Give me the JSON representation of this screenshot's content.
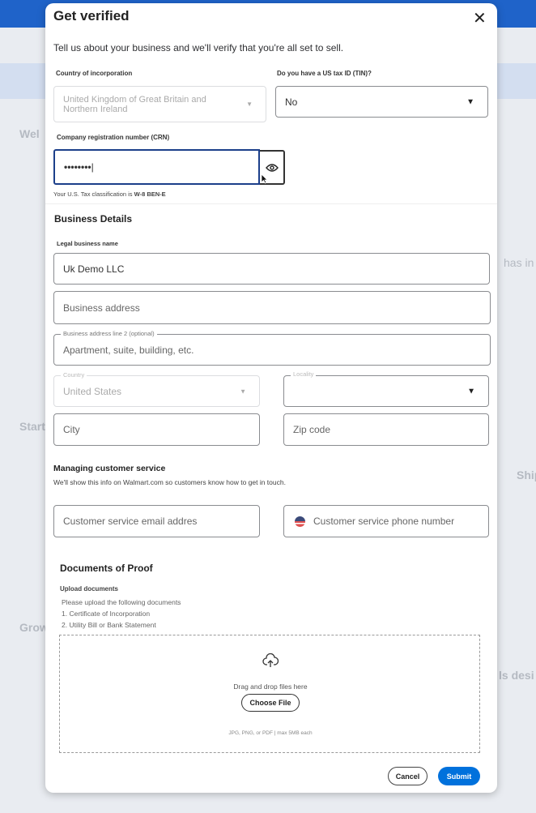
{
  "background": {
    "fragments": [
      "Wel",
      "has in",
      "Start",
      "Grow",
      "Ship",
      "ls desi"
    ]
  },
  "modal": {
    "title": "Get verified",
    "intro": "Tell us about your business and we'll verify that you're all set to sell.",
    "country_of_incorporation": {
      "label": "Country of incorporation",
      "value": "United Kingdom of Great Britain and Northern Ireland"
    },
    "us_tax_id": {
      "label": "Do you have a US tax ID (TIN)?",
      "value": "No"
    },
    "crn": {
      "label": "Company registration number (CRN)",
      "value": "••••••••"
    },
    "tax_classification": {
      "prefix": "Your U.S. Tax classification is",
      "value": "W-8 BEN-E"
    },
    "business_details": {
      "heading": "Business Details",
      "legal_name_label": "Legal business name",
      "legal_name_value": "Uk Demo LLC",
      "address_placeholder": "Business address",
      "address2_label": "Business address line 2 (optional)",
      "address2_placeholder": "Apartment, suite, building, etc.",
      "country_label": "Country",
      "country_value": "United States",
      "locality_label": "Locality",
      "city_placeholder": "City",
      "zip_placeholder": "Zip code"
    },
    "customer_service": {
      "heading": "Managing customer service",
      "description": "We'll show this info on Walmart.com so customers know how to get in touch.",
      "email_placeholder": "Customer service email addres",
      "phone_placeholder": "Customer service phone number"
    },
    "documents": {
      "heading": "Documents of Proof",
      "upload_label": "Upload documents",
      "instructions": [
        "Please upload the following documents",
        "1. Certificate of Incorporation",
        "2. Utility Bill or Bank Statement"
      ],
      "drop_text": "Drag and drop files here",
      "choose_file": "Choose File",
      "file_hint": "JPG, PNG, or PDF | max 5MB each"
    },
    "cancel": "Cancel",
    "submit": "Submit"
  },
  "colors": {
    "accent": "#0071dc",
    "header": "#1f63c9"
  }
}
